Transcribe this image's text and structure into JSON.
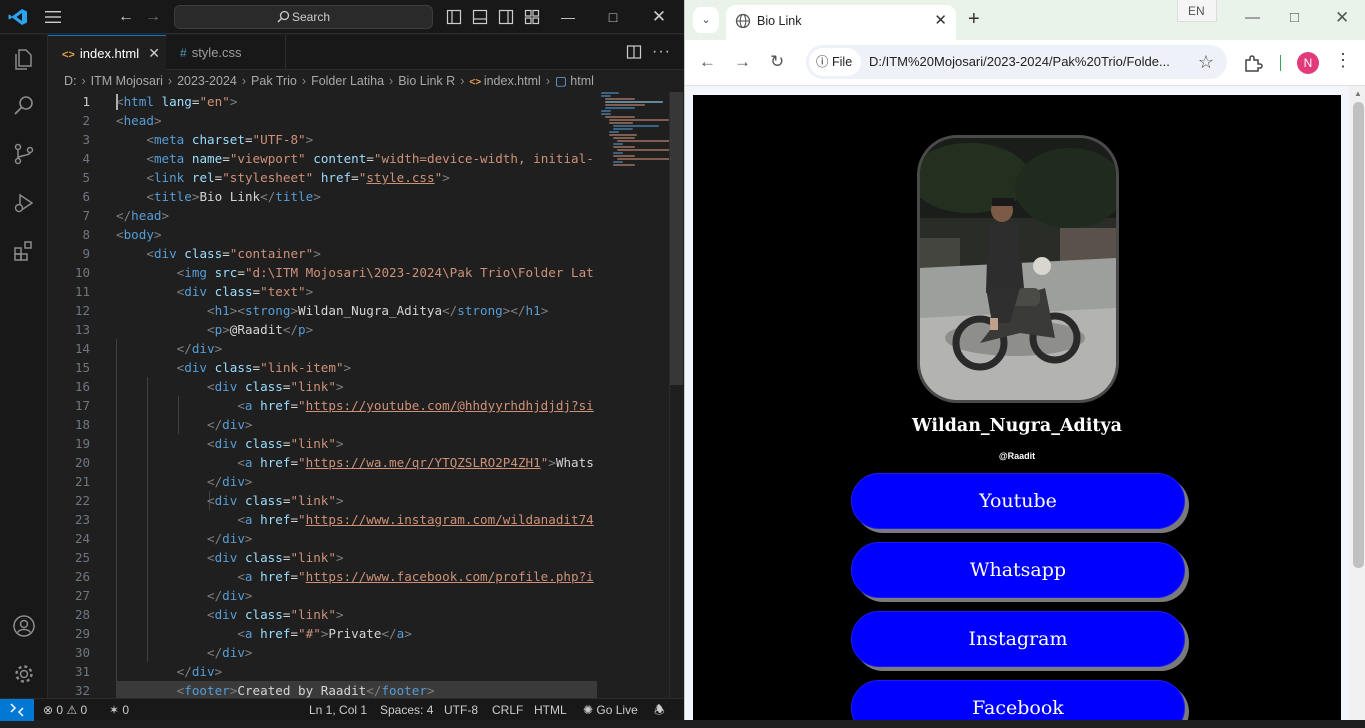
{
  "vscode": {
    "search_placeholder": "Search",
    "tabs": [
      {
        "label": "index.html",
        "icon": "html-file-icon"
      },
      {
        "label": "style.css",
        "icon": "css-file-icon"
      }
    ],
    "breadcrumb": [
      "D:",
      "ITM Mojosari",
      "2023-2024",
      "Pak Trio",
      "Folder Latiha",
      "Bio Link R",
      "index.html",
      "html"
    ],
    "line_numbers": [
      "1",
      "2",
      "3",
      "4",
      "5",
      "6",
      "7",
      "8",
      "9",
      "10",
      "11",
      "12",
      "13",
      "14",
      "15",
      "16",
      "17",
      "18",
      "19",
      "20",
      "21",
      "22",
      "23",
      "24",
      "25",
      "26",
      "27",
      "28",
      "29",
      "30",
      "31",
      "32"
    ],
    "code": {
      "l10_src": "d:\\ITM Mojosari\\2023-2024\\Pak Trio\\Folder Lat",
      "l12_text": "Wildan_Nugra_Aditya",
      "l13_text": "@Raadit",
      "l17_url": "https://youtube.com/@hhdyyrhdhjdjdj?si",
      "l20_url": "https://wa.me/qr/YTQZSLRO2P4ZH1",
      "l20_after": "Whats",
      "l23_url": "https://www.instagram.com/wildanadit74",
      "l26_url": "https://www.facebook.com/profile.php?i",
      "l29_text": "Private",
      "l32_text": "Created by Raadit"
    },
    "status": {
      "errors": "0",
      "warnings": "0",
      "ports": "0",
      "position": "Ln 1, Col 1",
      "spaces": "Spaces: 4",
      "encoding": "UTF-8",
      "eol": "CRLF",
      "language": "HTML",
      "golive": "Go Live"
    }
  },
  "chrome": {
    "tab_title": "Bio Link",
    "lang": "EN",
    "chip": "File",
    "url": "D:/ITM%20Mojosari/2023-2024/Pak%20Trio/Folde...",
    "avatar": "N"
  },
  "page": {
    "name": "Wildan_Nugra_Aditya",
    "handle": "@Raadit",
    "links": [
      "Youtube",
      "Whatsapp",
      "Instagram",
      "Facebook"
    ],
    "link_color": "#0000ff"
  }
}
